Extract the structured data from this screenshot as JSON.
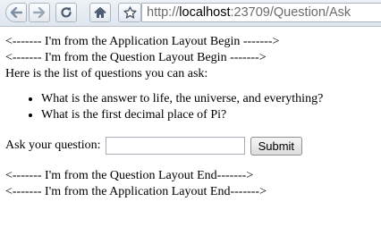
{
  "browser": {
    "address": {
      "scheme": "http://",
      "host": "localhost",
      "rest": ":23709/Question/Ask"
    },
    "icons": {
      "back": "back-arrow-icon",
      "forward": "forward-arrow-icon",
      "reload": "reload-icon",
      "home": "home-icon",
      "bookmark": "star-icon"
    }
  },
  "page": {
    "app_layout_begin": "<------- I'm from the Application Layout Begin ------->",
    "question_layout_begin": "<------- I'm from the Question Layout Begin ------->",
    "intro": "Here is the list of questions you can ask:",
    "questions": [
      "What is the answer to life, the universe, and everything?",
      "What is the first decimal place of Pi?"
    ],
    "ask_label": "Ask your question:",
    "ask_input_value": "",
    "submit_label": "Submit",
    "question_layout_end": "<------- I'm from the Question Layout End------->",
    "app_layout_end": "<------- I'm from the Application Layout End------->"
  }
}
